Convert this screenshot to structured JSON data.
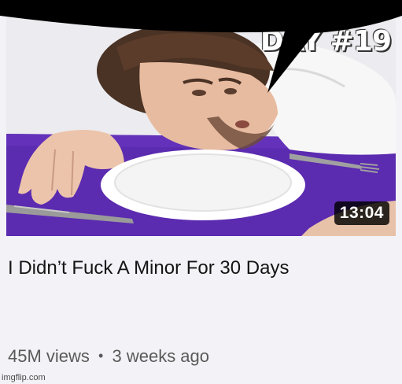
{
  "thumbnail": {
    "overlay_text": "DAY #19",
    "duration": "13:04"
  },
  "video": {
    "title": "I Didn’t Fuck A Minor For 30 Days",
    "views": "45M views",
    "separator": "•",
    "age": "3 weeks ago"
  },
  "watermark": "imgflip.com",
  "colors": {
    "background": "#f2f2f7",
    "tablecloth": "#5b2bb0",
    "duration_bg": "#000000",
    "title_text": "#141414",
    "meta_text": "#5a5a5a"
  }
}
